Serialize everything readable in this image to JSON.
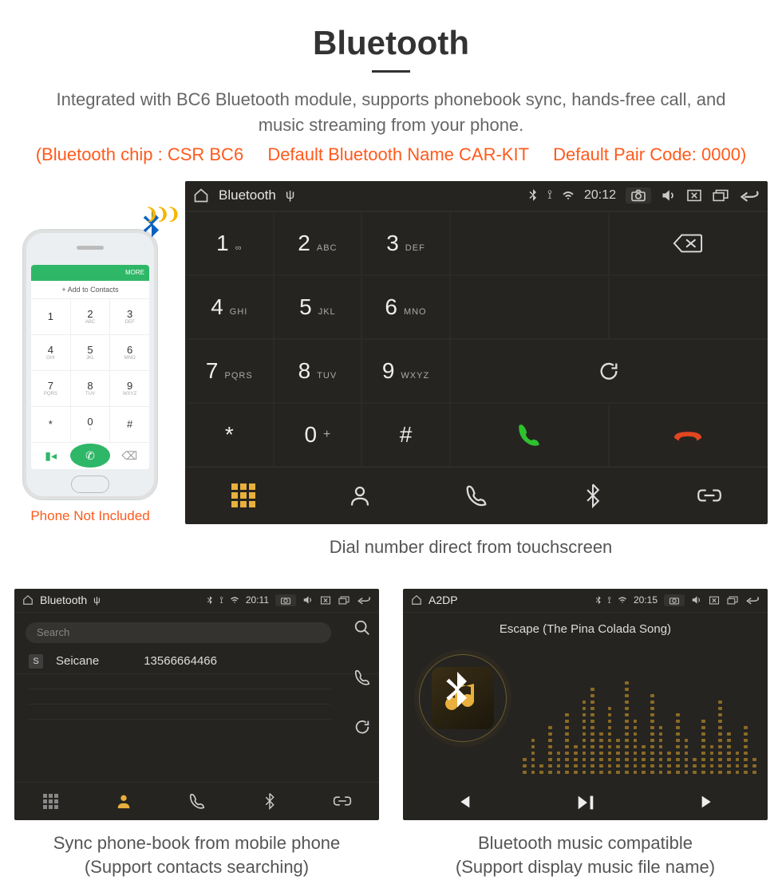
{
  "header": {
    "title": "Bluetooth",
    "subtitle": "Integrated with BC6 Bluetooth module, supports phonebook sync, hands-free call, and music streaming from your phone.",
    "spec_chip": "(Bluetooth chip : CSR BC6",
    "spec_name": "Default Bluetooth Name CAR-KIT",
    "spec_code": "Default Pair Code: 0000)"
  },
  "phone": {
    "top_label": "MORE",
    "add_label": "+  Add to Contacts",
    "keys": [
      {
        "n": "1",
        "s": ""
      },
      {
        "n": "2",
        "s": "ABC"
      },
      {
        "n": "3",
        "s": "DEF"
      },
      {
        "n": "4",
        "s": "GHI"
      },
      {
        "n": "5",
        "s": "JKL"
      },
      {
        "n": "6",
        "s": "MNO"
      },
      {
        "n": "7",
        "s": "PQRS"
      },
      {
        "n": "8",
        "s": "TUV"
      },
      {
        "n": "9",
        "s": "WXYZ"
      },
      {
        "n": "*",
        "s": ""
      },
      {
        "n": "0",
        "s": "+"
      },
      {
        "n": "#",
        "s": ""
      }
    ],
    "caption": "Phone Not Included"
  },
  "main_panel": {
    "status": {
      "title": "Bluetooth",
      "time": "20:12"
    },
    "keys": [
      {
        "n": "1",
        "s": "∞"
      },
      {
        "n": "2",
        "s": "ABC"
      },
      {
        "n": "3",
        "s": "DEF"
      },
      {
        "n": "4",
        "s": "GHI"
      },
      {
        "n": "5",
        "s": "JKL"
      },
      {
        "n": "6",
        "s": "MNO"
      },
      {
        "n": "7",
        "s": "PQRS"
      },
      {
        "n": "8",
        "s": "TUV"
      },
      {
        "n": "9",
        "s": "WXYZ"
      },
      {
        "n": "*",
        "s": ""
      },
      {
        "n": "0",
        "s": "+"
      },
      {
        "n": "#",
        "s": ""
      }
    ],
    "caption": "Dial number direct from touchscreen"
  },
  "contacts_panel": {
    "status": {
      "title": "Bluetooth",
      "time": "20:11"
    },
    "search_placeholder": "Search",
    "contact": {
      "badge": "S",
      "name": "Seicane",
      "number": "13566664466"
    },
    "caption_line1": "Sync phone-book from mobile phone",
    "caption_line2": "(Support contacts searching)"
  },
  "music_panel": {
    "status": {
      "title": "A2DP",
      "time": "20:15"
    },
    "song": "Escape (The Pina Colada Song)",
    "caption_line1": "Bluetooth music compatible",
    "caption_line2": "(Support display music file name)"
  }
}
